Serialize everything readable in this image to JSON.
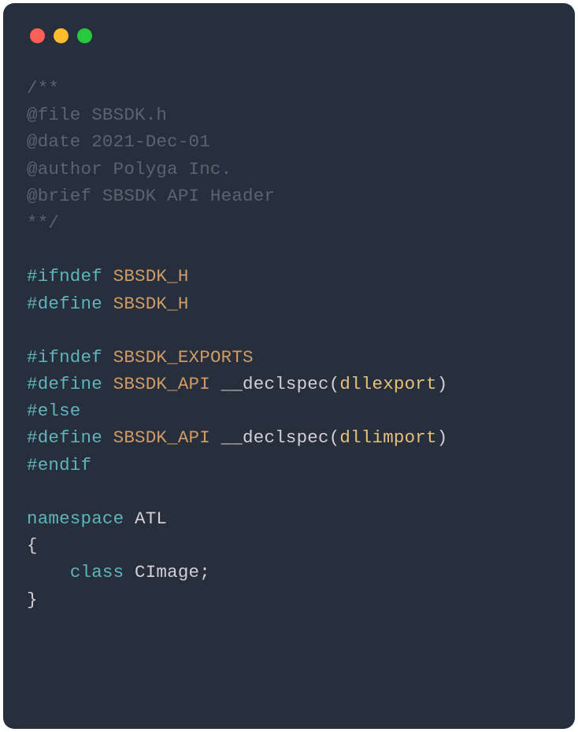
{
  "window": {
    "traffic_lights": {
      "red": "#ff5f56",
      "yellow": "#ffbd2e",
      "green": "#27c93f"
    }
  },
  "code": {
    "l1": "/**",
    "l2": "@file SBSDK.h",
    "l3": "@date 2021-Dec-01",
    "l4": "@author Polyga Inc.",
    "l5": "@brief SBSDK API Header",
    "l6": "**/",
    "l7_a": "#ifndef",
    "l7_b": " SBSDK_H",
    "l8_a": "#define",
    "l8_b": " SBSDK_H",
    "l9_a": "#ifndef",
    "l9_b": " SBSDK_EXPORTS",
    "l10_a": "#define",
    "l10_b": " SBSDK_API ",
    "l10_c": "__declspec",
    "l10_d": "(",
    "l10_e": "dllexport",
    "l10_f": ")",
    "l11": "#else",
    "l12_a": "#define",
    "l12_b": " SBSDK_API ",
    "l12_c": "__declspec",
    "l12_d": "(",
    "l12_e": "dllimport",
    "l12_f": ")",
    "l13": "#endif",
    "l14_a": "namespace",
    "l14_b": " ATL",
    "l15": "{",
    "l16_a": "    ",
    "l16_b": "class",
    "l16_c": " CImage;",
    "l17": "}"
  }
}
